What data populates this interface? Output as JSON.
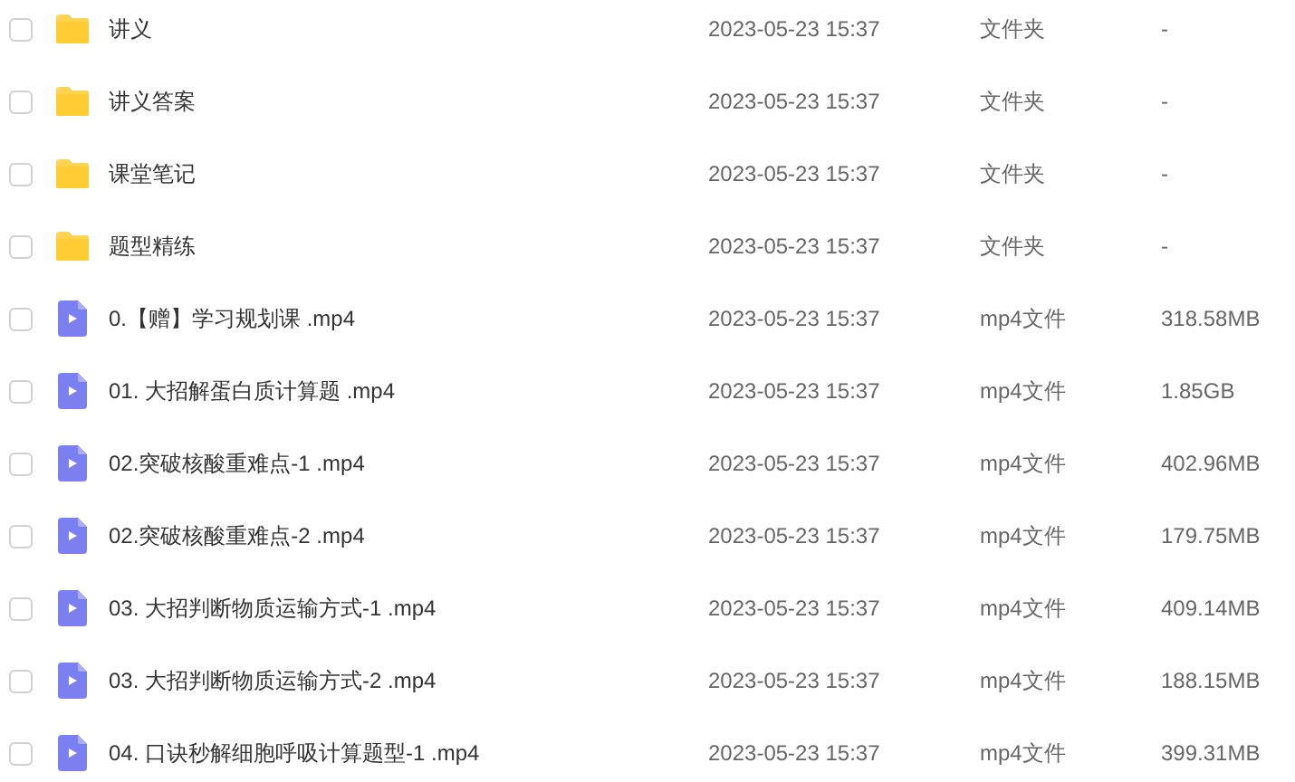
{
  "files": [
    {
      "kind": "folder",
      "checked": false,
      "name": "讲义",
      "modified": "2023-05-23 15:37",
      "type": "文件夹",
      "size": "-"
    },
    {
      "kind": "folder",
      "checked": false,
      "name": "讲义答案",
      "modified": "2023-05-23 15:37",
      "type": "文件夹",
      "size": "-"
    },
    {
      "kind": "folder",
      "checked": false,
      "name": "课堂笔记",
      "modified": "2023-05-23 15:37",
      "type": "文件夹",
      "size": "-"
    },
    {
      "kind": "folder",
      "checked": false,
      "name": "题型精练",
      "modified": "2023-05-23 15:37",
      "type": "文件夹",
      "size": "-"
    },
    {
      "kind": "video",
      "checked": false,
      "name": "0.【赠】学习规划课 .mp4",
      "modified": "2023-05-23 15:37",
      "type": "mp4文件",
      "size": "318.58MB"
    },
    {
      "kind": "video",
      "checked": false,
      "name": "01. 大招解蛋白质计算题 .mp4",
      "modified": "2023-05-23 15:37",
      "type": "mp4文件",
      "size": "1.85GB"
    },
    {
      "kind": "video",
      "checked": false,
      "name": "02.突破核酸重难点-1 .mp4",
      "modified": "2023-05-23 15:37",
      "type": "mp4文件",
      "size": "402.96MB"
    },
    {
      "kind": "video",
      "checked": false,
      "name": "02.突破核酸重难点-2 .mp4",
      "modified": "2023-05-23 15:37",
      "type": "mp4文件",
      "size": "179.75MB"
    },
    {
      "kind": "video",
      "checked": false,
      "name": "03. 大招判断物质运输方式-1 .mp4",
      "modified": "2023-05-23 15:37",
      "type": "mp4文件",
      "size": "409.14MB"
    },
    {
      "kind": "video",
      "checked": false,
      "name": "03. 大招判断物质运输方式-2 .mp4",
      "modified": "2023-05-23 15:37",
      "type": "mp4文件",
      "size": "188.15MB"
    },
    {
      "kind": "video",
      "checked": false,
      "name": "04. 口诀秒解细胞呼吸计算题型-1 .mp4",
      "modified": "2023-05-23 15:37",
      "type": "mp4文件",
      "size": "399.31MB"
    }
  ]
}
